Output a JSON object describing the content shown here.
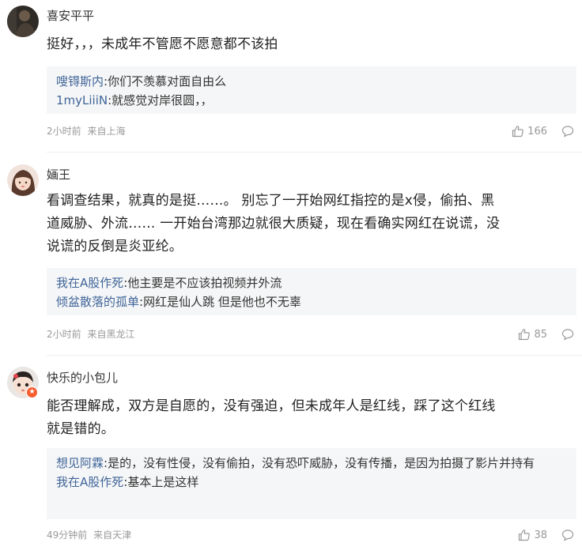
{
  "comments": [
    {
      "username": "喜安平平",
      "content": "挺好，，，未成年不管愿不愿意都不该拍",
      "replies": [
        {
          "name": "嗖锝斯内",
          "text": ":你们不羡慕对面自由么"
        },
        {
          "name": "1myLiiiN",
          "text": ":就感觉对岸很圆，，"
        }
      ],
      "time": "2小时前",
      "location": "来自上海",
      "likes": "166"
    },
    {
      "username": "婳王",
      "content_lines": [
        "看调查结果，就真的是挺……。 别忘了一开始网红指控的是x侵，偷拍、黑",
        "道威胁、外流…… 一开始台湾那边就很大质疑，现在看确实网红在说谎，没",
        "说谎的反倒是炎亚纶。"
      ],
      "replies": [
        {
          "name": "我在A股作死",
          "text": ":他主要是不应该拍视频并外流"
        },
        {
          "name": "倾盆散落的孤单",
          "text": ":网红是仙人跳 但是他也不无辜"
        }
      ],
      "time": "2小时前",
      "location": "来自黑龙江",
      "likes": "85"
    },
    {
      "username": "快乐的小包儿",
      "content_lines": [
        "能否理解成，双方是自愿的，没有强迫，但未成年人是红线，踩了这个红线",
        "就是错的。"
      ],
      "replies": [
        {
          "name": "想见阿霖",
          "text": ":是的，没有性侵，没有偷拍，没有恐吓威胁，没有传播，是因为拍摄了影片并持有"
        },
        {
          "name": "我在A股作死",
          "text": ":基本上是这样"
        }
      ],
      "time": "49分钟前",
      "location": "来自天津",
      "likes": "38"
    }
  ],
  "icons": {
    "like": "thumbs-up-icon",
    "reply": "comment-bubble-icon",
    "badge": "star-badge-icon"
  },
  "colors": {
    "reply_name": "#406599",
    "meta": "#999999",
    "reply_bg": "#f5f6f7"
  }
}
